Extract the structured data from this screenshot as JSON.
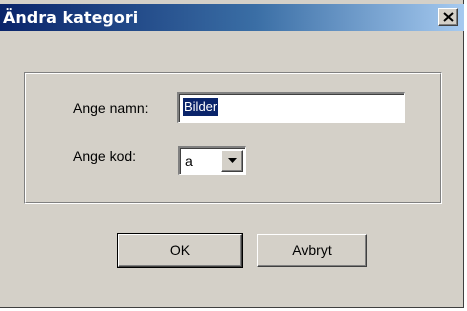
{
  "window": {
    "title": "Ändra kategori",
    "close_icon": "close-icon"
  },
  "form": {
    "name_label": "Ange namn:",
    "name_value": "Bilder",
    "code_label": "Ange kod:",
    "code_value": "a",
    "dropdown_icon": "chevron-down-icon"
  },
  "buttons": {
    "ok_label": "OK",
    "cancel_label": "Avbryt"
  },
  "colors": {
    "titlebar_start": "#0a246a",
    "titlebar_end": "#a6caf0",
    "dialog_bg": "#d4d0c8",
    "selection_bg": "#0a246a"
  }
}
